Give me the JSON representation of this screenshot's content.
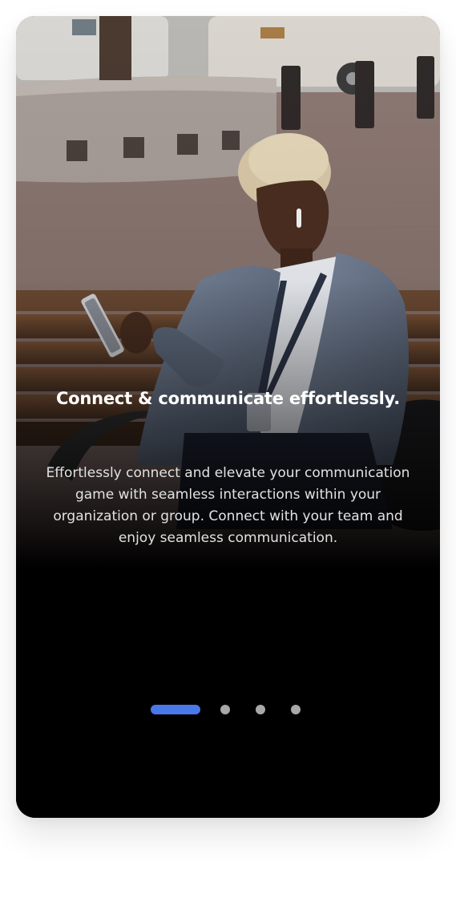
{
  "onboarding": {
    "title": "Connect & communicate effortlessly.",
    "description": "Effortlessly connect and elevate your communication game with seamless interactions within your organization or group. Connect with your team and enjoy seamless communication.",
    "pagination": {
      "total_pages": 4,
      "current_page": 1
    }
  },
  "colors": {
    "accent": "#4a77ea",
    "inactive_dot": "#a8a8a8",
    "card_background": "#000000",
    "title_text": "#ffffff",
    "body_text": "#e2e2e2"
  }
}
